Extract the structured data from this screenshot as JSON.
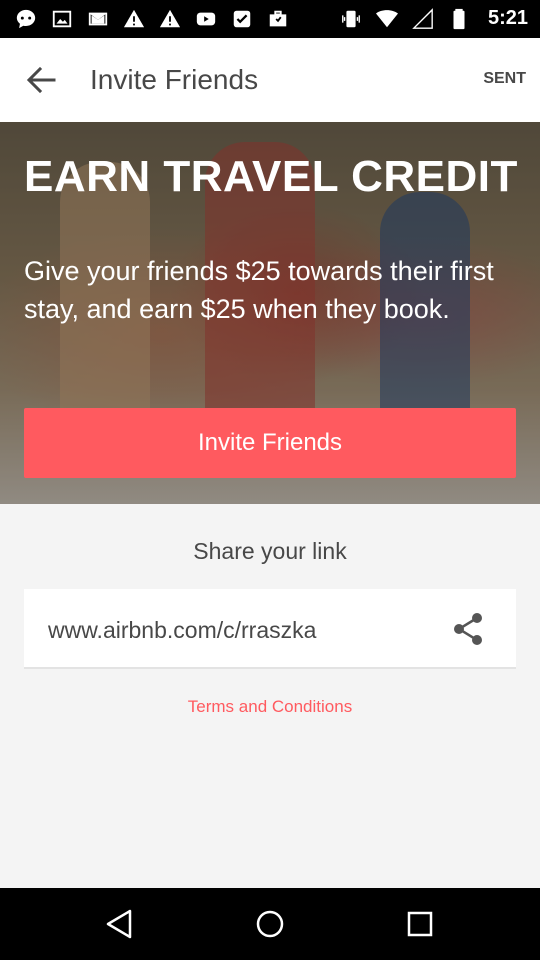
{
  "status_bar": {
    "time": "5:21",
    "left_icons": [
      "chat-icon",
      "image-icon",
      "gmail-icon",
      "warning-icon",
      "warning-icon",
      "youtube-icon",
      "task-check-icon",
      "briefcase-icon"
    ],
    "right_icons": [
      "vibrate-icon",
      "wifi-icon",
      "signal-icon",
      "battery-icon"
    ]
  },
  "app_bar": {
    "title": "Invite Friends",
    "action_label": "SENT"
  },
  "hero": {
    "heading": "EARN TRAVEL CREDIT",
    "subtitle": "Give your friends $25 towards their first stay, and earn $25 when they book.",
    "button_label": "Invite Friends"
  },
  "share": {
    "heading": "Share your link",
    "link": "www.airbnb.com/c/rraszka",
    "terms_label": "Terms and Conditions"
  },
  "colors": {
    "accent": "#ff5a5f",
    "text": "#484848",
    "background": "#f4f4f4"
  },
  "nav_bar": {
    "icons": [
      "back-triangle-icon",
      "home-circle-icon",
      "recents-square-icon"
    ]
  }
}
